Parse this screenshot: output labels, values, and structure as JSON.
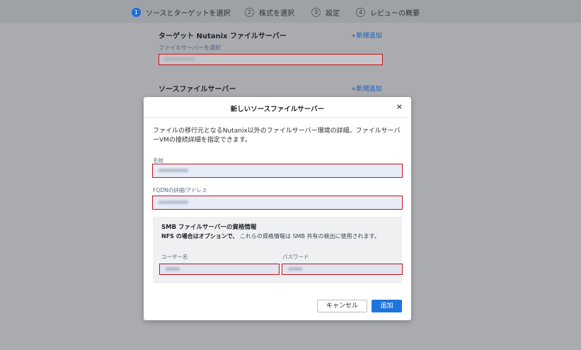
{
  "stepper": {
    "steps": [
      {
        "num": "1",
        "label": "ソースとターゲットを選択"
      },
      {
        "num": "2",
        "label": "株式を選択"
      },
      {
        "num": "3",
        "label": "設定"
      },
      {
        "num": "4",
        "label": "レビューの概要"
      }
    ]
  },
  "background": {
    "target_title": "ターゲット Nutanix ファイルサーバー",
    "target_add": "+新規追加",
    "target_field_label": "ファイルサーバーを選択",
    "source_title": "ソースファイルサーバー",
    "source_add": "+新規追加"
  },
  "modal": {
    "title": "新しいソースファイルサーバー",
    "close": "×",
    "description": "ファイルの移行元となるNutanix以外のファイルサーバー環境の詳細。ファイルサーバーVMの接続詳細を指定できます。",
    "name_label": "名前",
    "fqdn_label": "FQDNの詳細/アドレス",
    "smb": {
      "title": "SMB ファイルサーバーの資格情報",
      "note_bold": "NFS の場合はオプションで、",
      "note_rest": " これらの資格情報は SMB 共有の検出に使用されます。",
      "username_label": "ユーザー名",
      "password_label": "パスワード"
    },
    "cancel_label": "キャンセル",
    "add_label": "追加"
  },
  "colors": {
    "accent": "#1f74dc",
    "highlight_border": "#c8141c",
    "overlay": "#a9abaf"
  }
}
